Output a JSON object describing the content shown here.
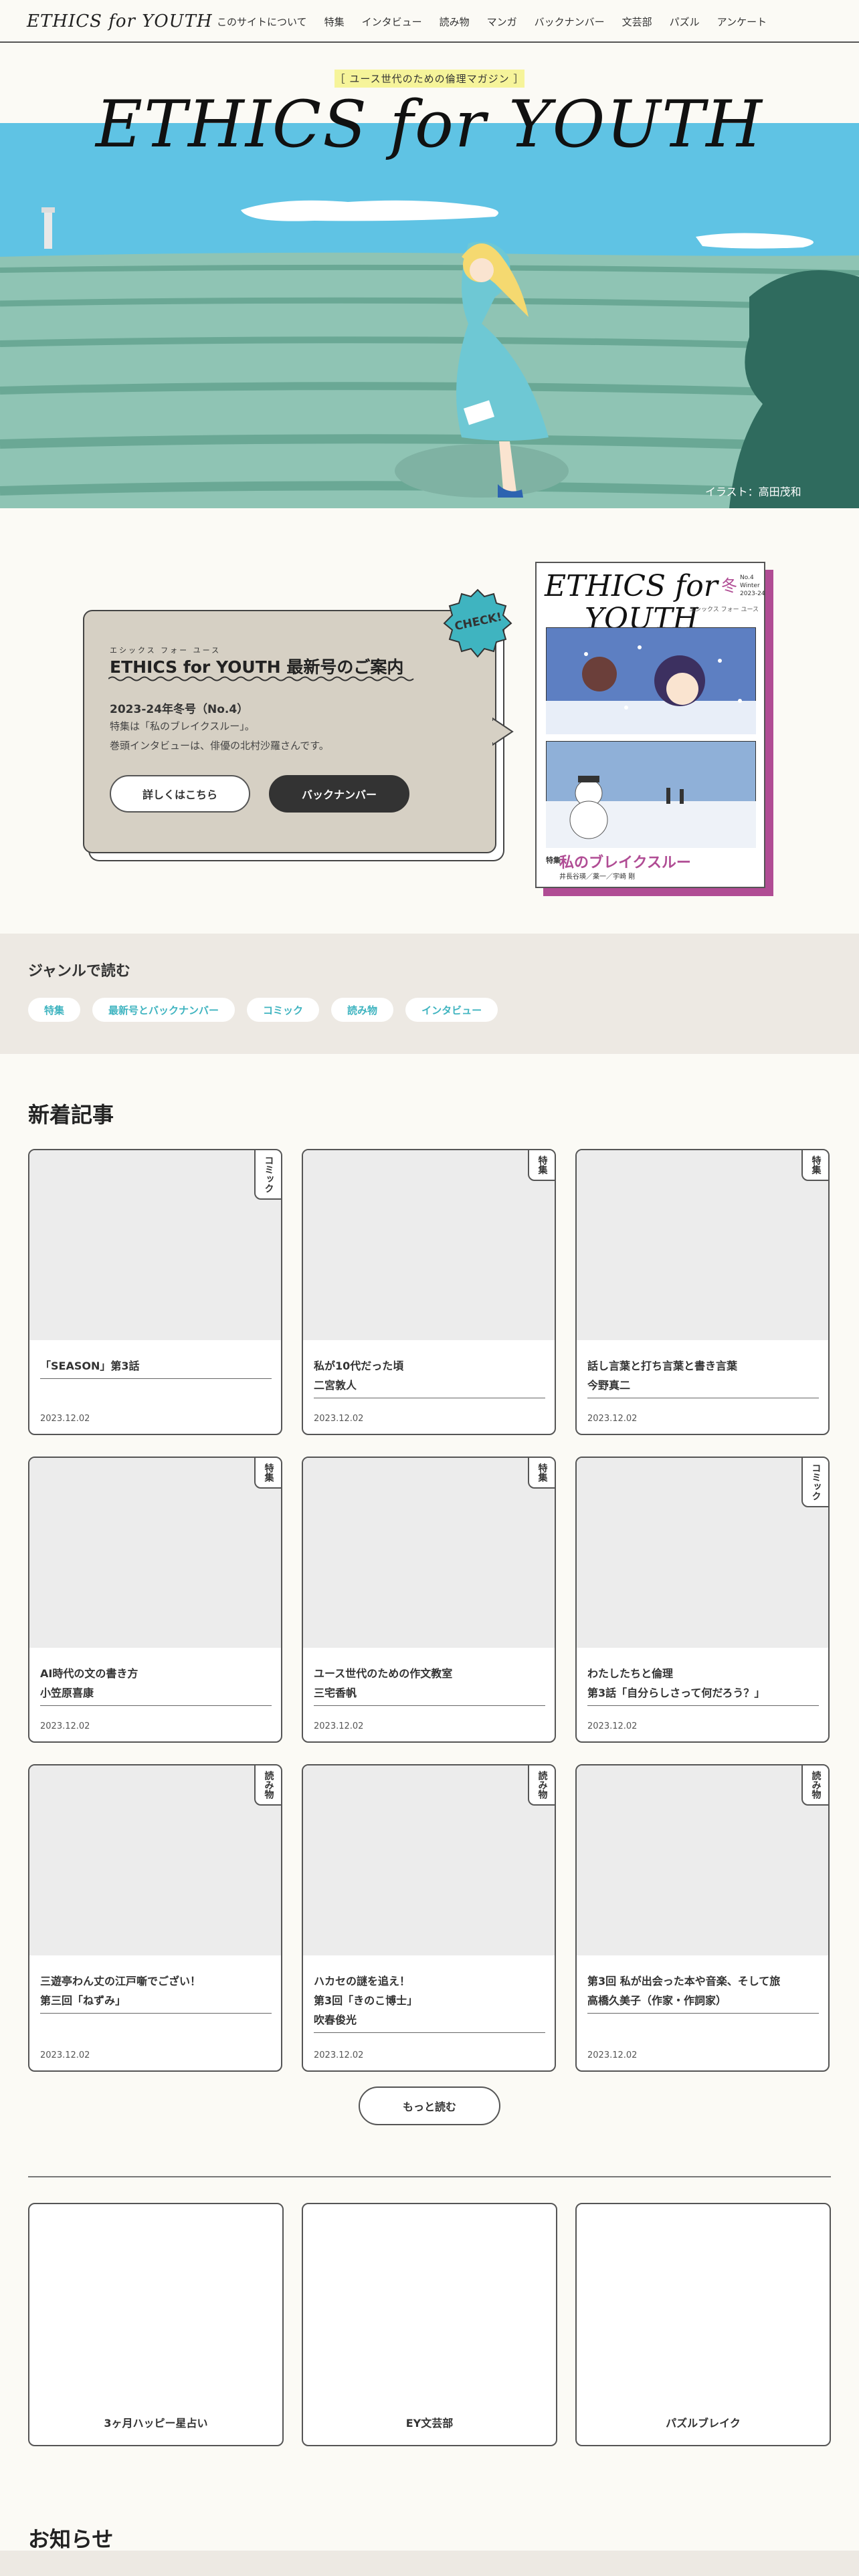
{
  "header": {
    "logo": "ETHICS for YOUTH",
    "nav": [
      "このサイトについて",
      "特集",
      "インタビュー",
      "読み物",
      "マンガ",
      "バックナンバー",
      "文芸部",
      "パズル",
      "アンケート"
    ]
  },
  "hero": {
    "tagline": "［ ユース世代のための倫理マガジン ］",
    "title": "ETHICS for YOUTH",
    "credit": "イラスト：高田茂和"
  },
  "latest": {
    "ruby": "エシックス フォー ユース",
    "title": "ETHICS for YOUTH 最新号のご案内",
    "issue": "2023-24年冬号（No.4）",
    "line1": "特集は「私のブレイクスルー」。",
    "line2": "巻頭インタビューは、俳優の北村沙羅さんです。",
    "details_button": "詳しくはこちら",
    "backnumber_button": "バックナンバー",
    "badge": "CHECK!"
  },
  "cover": {
    "title_line1": "ETHICS for",
    "title_line2": "YOUTH",
    "season": "冬",
    "issue_no": "No.4",
    "issue_season": "Winter",
    "issue_year": "2023-24",
    "kana": "エシックス フォー ユース",
    "feature_label": "特集",
    "feature_title": "私のブレイクスルー",
    "names": "井長谷瑛／薬一／宇崎 剛"
  },
  "genres": {
    "title": "ジャンルで読む",
    "tags": [
      "特集",
      "最新号とバックナンバー",
      "コミック",
      "読み物",
      "インタビュー"
    ]
  },
  "news": {
    "title": "新着記事",
    "cards": [
      {
        "tag": "コミック",
        "line1": "「SEASON」第3話",
        "line2": "",
        "line3": "",
        "date": "2023.12.02"
      },
      {
        "tag": "特集",
        "line1": "私が10代だった頃",
        "line2": "二宮敦人",
        "line3": "",
        "date": "2023.12.02"
      },
      {
        "tag": "特集",
        "line1": "話し言葉と打ち言葉と書き言葉",
        "line2": "今野真二",
        "line3": "",
        "date": "2023.12.02"
      },
      {
        "tag": "特集",
        "line1": "AI時代の文の書き方",
        "line2": "小笠原喜康",
        "line3": "",
        "date": "2023.12.02"
      },
      {
        "tag": "特集",
        "line1": "ユース世代のための作文教室",
        "line2": "三宅香帆",
        "line3": "",
        "date": "2023.12.02"
      },
      {
        "tag": "コミック",
        "line1": "わたしたちと倫理",
        "line2": "第3話「自分らしさって何だろう？」",
        "line3": "",
        "date": "2023.12.02"
      },
      {
        "tag": "読み物",
        "line1": "三遊亭わん丈の江戸噺でござい！",
        "line2": "第三回「ねずみ」",
        "line3": "",
        "date": "2023.12.02"
      },
      {
        "tag": "読み物",
        "line1": "ハカセの謎を追え！",
        "line2": "第3回「きのこ博士」",
        "line3": "吹春俊光",
        "date": "2023.12.02"
      },
      {
        "tag": "読み物",
        "line1": "第3回 私が出会った本や音楽、そして旅",
        "line2": "高橋久美子（作家・作詞家）",
        "line3": "",
        "date": "2023.12.02"
      }
    ],
    "more_button": "もっと読む"
  },
  "promos": [
    "3ヶ月ハッピー星占い",
    "EY文芸部",
    "パズルブレイク"
  ],
  "notice": {
    "title": "お知らせ"
  },
  "colors": {
    "accent": "#3fb4c0",
    "bubble": "#d6d0c4",
    "band": "#ede9e3",
    "highlight": "#f6f49a"
  }
}
